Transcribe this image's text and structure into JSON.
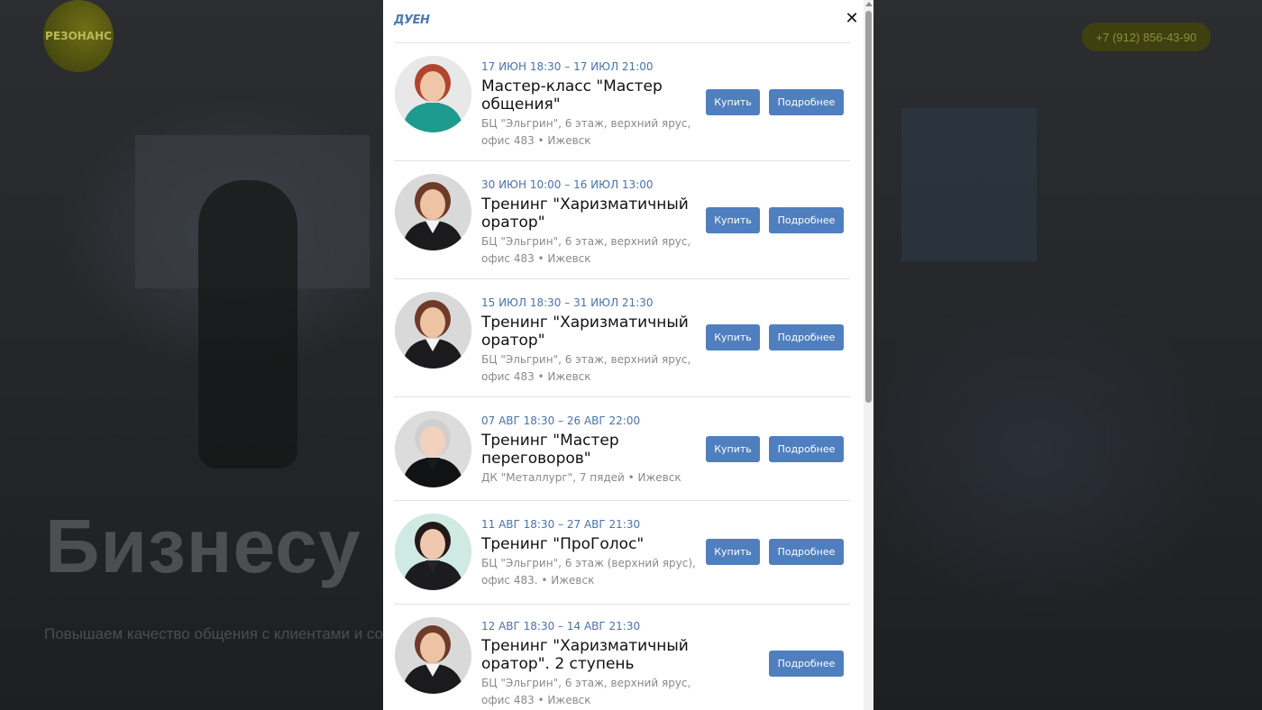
{
  "background": {
    "logo_text": "РЕЗОНАНС",
    "phone": "+7 (912) 856-43-90",
    "hero_title": "Бизнесу",
    "hero_subtitle": "Повышаем качество общения с клиентами и со"
  },
  "modal": {
    "brand": "ДУЕН",
    "close_glyph": "✕",
    "buy_label": "Купить",
    "more_label": "Подробнее"
  },
  "events": [
    {
      "date": "17 ИЮН 18:30 – 17 ИЮЛ 21:00",
      "title": "Мастер-класс \"Мастер общения\"",
      "place": "БЦ \"Эльгрин\", 6 этаж, верхний ярус, офис 483 • Ижевск",
      "has_buy": true,
      "portrait": "teal"
    },
    {
      "date": "30 ИЮН 10:00 – 16 ИЮЛ 13:00",
      "title": "Тренинг \"Харизматичный оратор\"",
      "place": "БЦ \"Эльгрин\", 6 этаж, верхний ярус, офис 483 • Ижевск",
      "has_buy": true,
      "portrait": "dark"
    },
    {
      "date": "15 ИЮЛ 18:30 – 31 ИЮЛ 21:30",
      "title": "Тренинг \"Харизматичный оратор\"",
      "place": "БЦ \"Эльгрин\", 6 этаж, верхний ярус, офис 483 • Ижевск",
      "has_buy": true,
      "portrait": "dark"
    },
    {
      "date": "07 АВГ 18:30 – 26 АВГ 22:00",
      "title": "Тренинг \"Мастер переговоров\"",
      "place": "ДК \"Металлург\", 7 пядей • Ижевск",
      "has_buy": true,
      "portrait": "grey"
    },
    {
      "date": "11 АВГ 18:30 – 27 АВГ 21:30",
      "title": "Тренинг \"ПроГолос\"",
      "place": "БЦ \"Эльгрин\", 6 этаж (верхний ярус), офис 483. • Ижевск",
      "has_buy": true,
      "portrait": "mint"
    },
    {
      "date": "12 АВГ 18:30 – 14 АВГ 21:30",
      "title": "Тренинг \"Харизматичный оратор\". 2 ступень",
      "place": "БЦ \"Эльгрин\", 6 этаж, верхний ярус, офис 483 • Ижевск",
      "has_buy": false,
      "portrait": "dark"
    }
  ]
}
